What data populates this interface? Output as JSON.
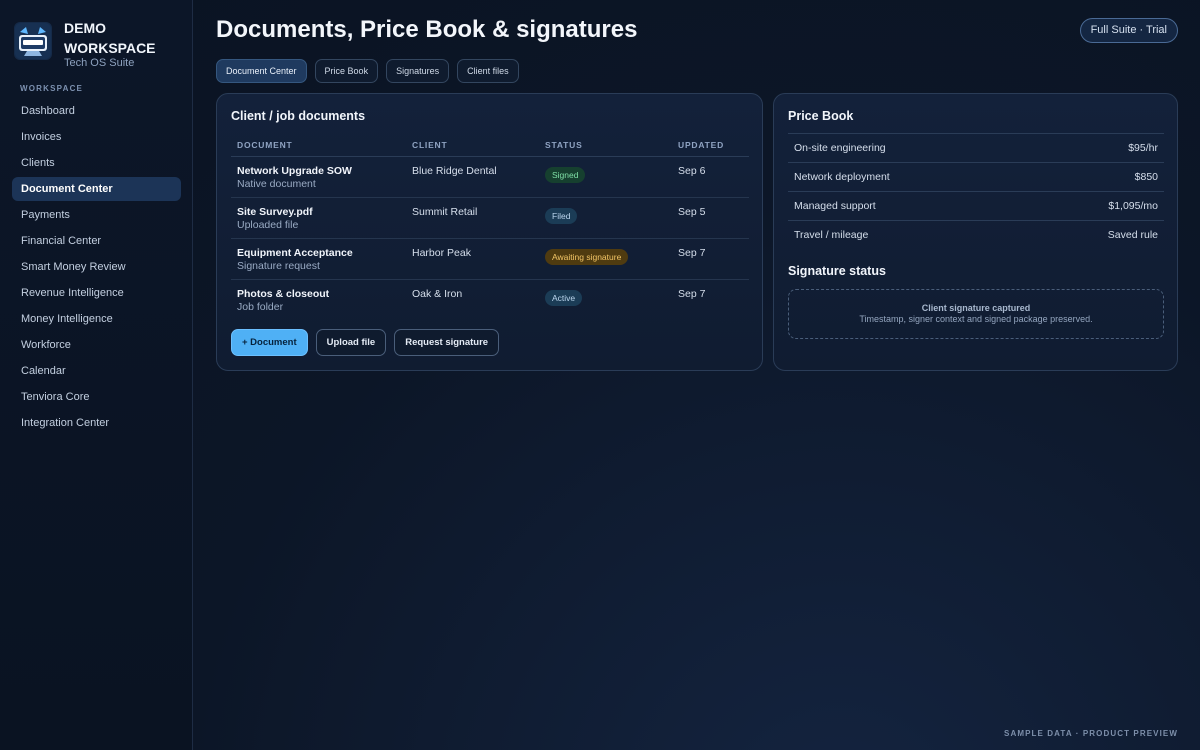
{
  "brand": {
    "name": "DEMO WORKSPACE",
    "subtitle": "Tech OS Suite",
    "logo_icon": "workspace-logo-icon"
  },
  "sidebar": {
    "section_label": "WORKSPACE",
    "items": [
      {
        "label": "Dashboard"
      },
      {
        "label": "Invoices"
      },
      {
        "label": "Clients"
      },
      {
        "label": "Document Center",
        "active": true
      },
      {
        "label": "Payments"
      },
      {
        "label": "Financial Center"
      },
      {
        "label": "Smart Money Review"
      },
      {
        "label": "Revenue Intelligence"
      },
      {
        "label": "Money Intelligence"
      },
      {
        "label": "Workforce"
      },
      {
        "label": "Calendar"
      },
      {
        "label": "Tenviora Core"
      },
      {
        "label": "Integration Center"
      }
    ]
  },
  "header": {
    "title": "Documents, Price Book & signatures",
    "plan_badge": "Full Suite · Trial"
  },
  "tabs": [
    {
      "label": "Document Center",
      "active": true
    },
    {
      "label": "Price Book"
    },
    {
      "label": "Signatures"
    },
    {
      "label": "Client files"
    }
  ],
  "documents": {
    "title": "Client / job documents",
    "columns": [
      "DOCUMENT",
      "CLIENT",
      "STATUS",
      "UPDATED"
    ],
    "rows": [
      {
        "name": "Network Upgrade SOW",
        "type": "Native document",
        "client": "Blue Ridge Dental",
        "status": "Signed",
        "updated": "Sep 6"
      },
      {
        "name": "Site Survey.pdf",
        "type": "Uploaded file",
        "client": "Summit Retail",
        "status": "Filed",
        "updated": "Sep 5"
      },
      {
        "name": "Equipment Acceptance",
        "type": "Signature request",
        "client": "Harbor Peak",
        "status": "Awaiting signature",
        "updated": "Sep 7"
      },
      {
        "name": "Photos & closeout",
        "type": "Job folder",
        "client": "Oak & Iron",
        "status": "Active",
        "updated": "Sep 7"
      }
    ],
    "actions": {
      "add": "+ Document",
      "upload": "Upload file",
      "request": "Request signature"
    }
  },
  "price_book": {
    "title": "Price Book",
    "items": [
      {
        "name": "On-site engineering",
        "price": "$95/hr"
      },
      {
        "name": "Network deployment",
        "price": "$850"
      },
      {
        "name": "Managed support",
        "price": "$1,095/mo"
      },
      {
        "name": "Travel / mileage",
        "price": "Saved rule"
      }
    ]
  },
  "signature": {
    "title": "Signature status",
    "headline": "Client signature captured",
    "detail": "Timestamp, signer context and signed package preserved."
  },
  "footer": {
    "note": "SAMPLE DATA · PRODUCT PREVIEW"
  },
  "colors": {
    "accent": "#4fb0f5",
    "signed": "#7fe0a6",
    "awaiting": "#f2c566",
    "background": "#0c1627"
  }
}
